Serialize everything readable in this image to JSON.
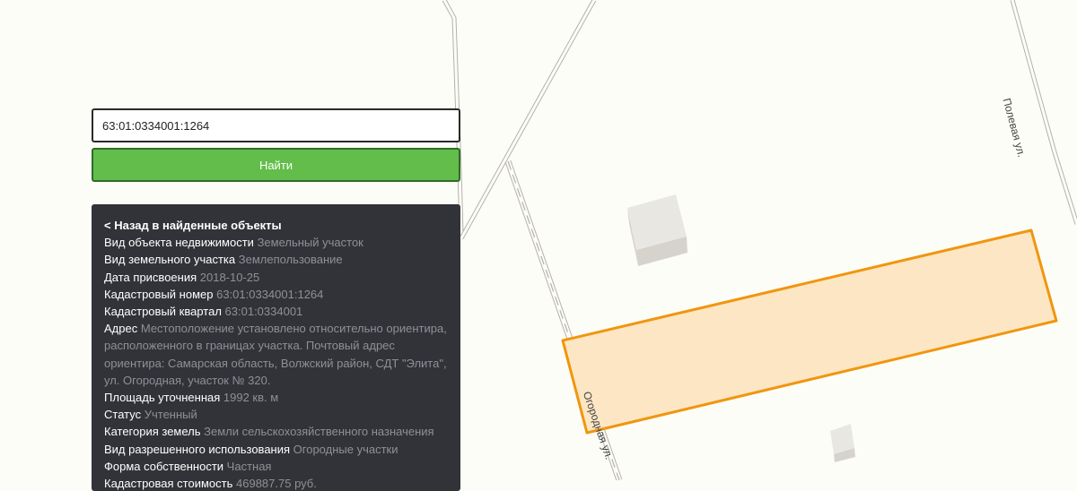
{
  "search": {
    "value": "63:01:0334001:1264",
    "button_label": "Найти"
  },
  "panel": {
    "back_label": "< Назад в найденные объекты",
    "rows": [
      {
        "label": "Вид объекта недвижимости",
        "value": "Земельный участок"
      },
      {
        "label": "Вид земельного участка",
        "value": "Землепользование"
      },
      {
        "label": "Дата присвоения",
        "value": "2018-10-25"
      },
      {
        "label": "Кадастровый номер",
        "value": "63:01:0334001:1264"
      },
      {
        "label": "Кадастровый квартал",
        "value": "63:01:0334001"
      },
      {
        "label": "Адрес",
        "value": "Местоположение установлено относительно ориентира, расположенного в границах участка. Почтовый адрес ориентира: Самарская область, Волжский район, СДТ \"Элита\", ул. Огородная, участок № 320."
      },
      {
        "label": "Площадь уточненная",
        "value": "1992 кв. м"
      },
      {
        "label": "Статус",
        "value": "Учтенный"
      },
      {
        "label": "Категория земель",
        "value": "Земли сельскохозяйственного назначения"
      },
      {
        "label": "Вид разрешенного использования",
        "value": "Огородные участки"
      },
      {
        "label": "Форма собственности",
        "value": "Частная"
      },
      {
        "label": "Кадастровая стоимость",
        "value": "469887.75 руб."
      }
    ]
  },
  "map": {
    "street_labels": {
      "polevaya": "Полевая ул.",
      "ogorodnaya": "Огородная ул."
    },
    "colors": {
      "parcel_fill": "#fde6c4",
      "parcel_stroke": "#f0960f",
      "background": "#fdfdf7"
    }
  }
}
